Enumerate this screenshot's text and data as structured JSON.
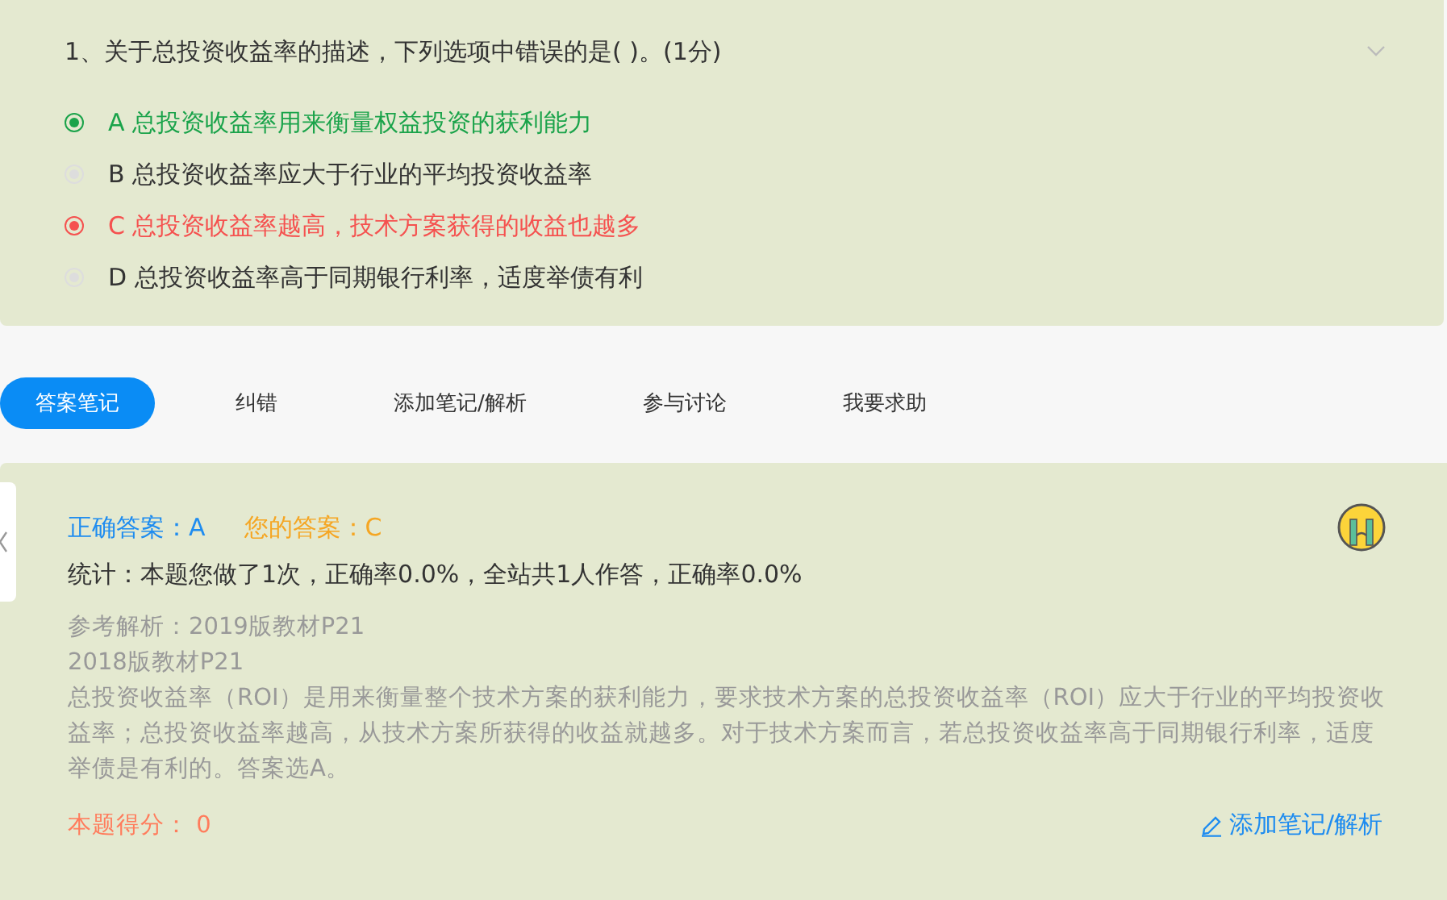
{
  "question": {
    "title": "1、关于总投资收益率的描述，下列选项中错误的是( )。(1分)",
    "options": [
      {
        "text": "A 总投资收益率用来衡量权益投资的获利能力",
        "kind": "correct",
        "selected": true
      },
      {
        "text": "B 总投资收益率应大于行业的平均投资收益率",
        "kind": "plain",
        "selected": false
      },
      {
        "text": "C 总投资收益率越高，技术方案获得的收益也越多",
        "kind": "wrong",
        "selected": true
      },
      {
        "text": "D 总投资收益率高于同期银行利率，适度举债有利",
        "kind": "plain",
        "selected": false
      }
    ]
  },
  "tabs": [
    {
      "label": "答案笔记",
      "selected": true
    },
    {
      "label": "纠错",
      "selected": false
    },
    {
      "label": "添加笔记/解析",
      "selected": false
    },
    {
      "label": "参与讨论",
      "selected": false
    },
    {
      "label": "我要求助",
      "selected": false
    }
  ],
  "answer": {
    "correct": "正确答案：A",
    "yours": "您的答案：C",
    "stats": "统计：本题您做了1次，正确率0.0%，全站共1人作答，正确率0.0%",
    "analysis": [
      "参考解析：2019版教材P21",
      "2018版教材P21",
      "总投资收益率（ROI）是用来衡量整个技术方案的获利能力，要求技术方案的总投资收益率（ROI）应大于行业的平均投资收益率；总投资收益率越高，从技术方案所获得的收益就越多。对于技术方案而言，若总投资收益率高于同期银行利率，适度举债是有利的。答案选A。"
    ],
    "score": "本题得分： 0",
    "add_note": "添加笔记/解析"
  }
}
